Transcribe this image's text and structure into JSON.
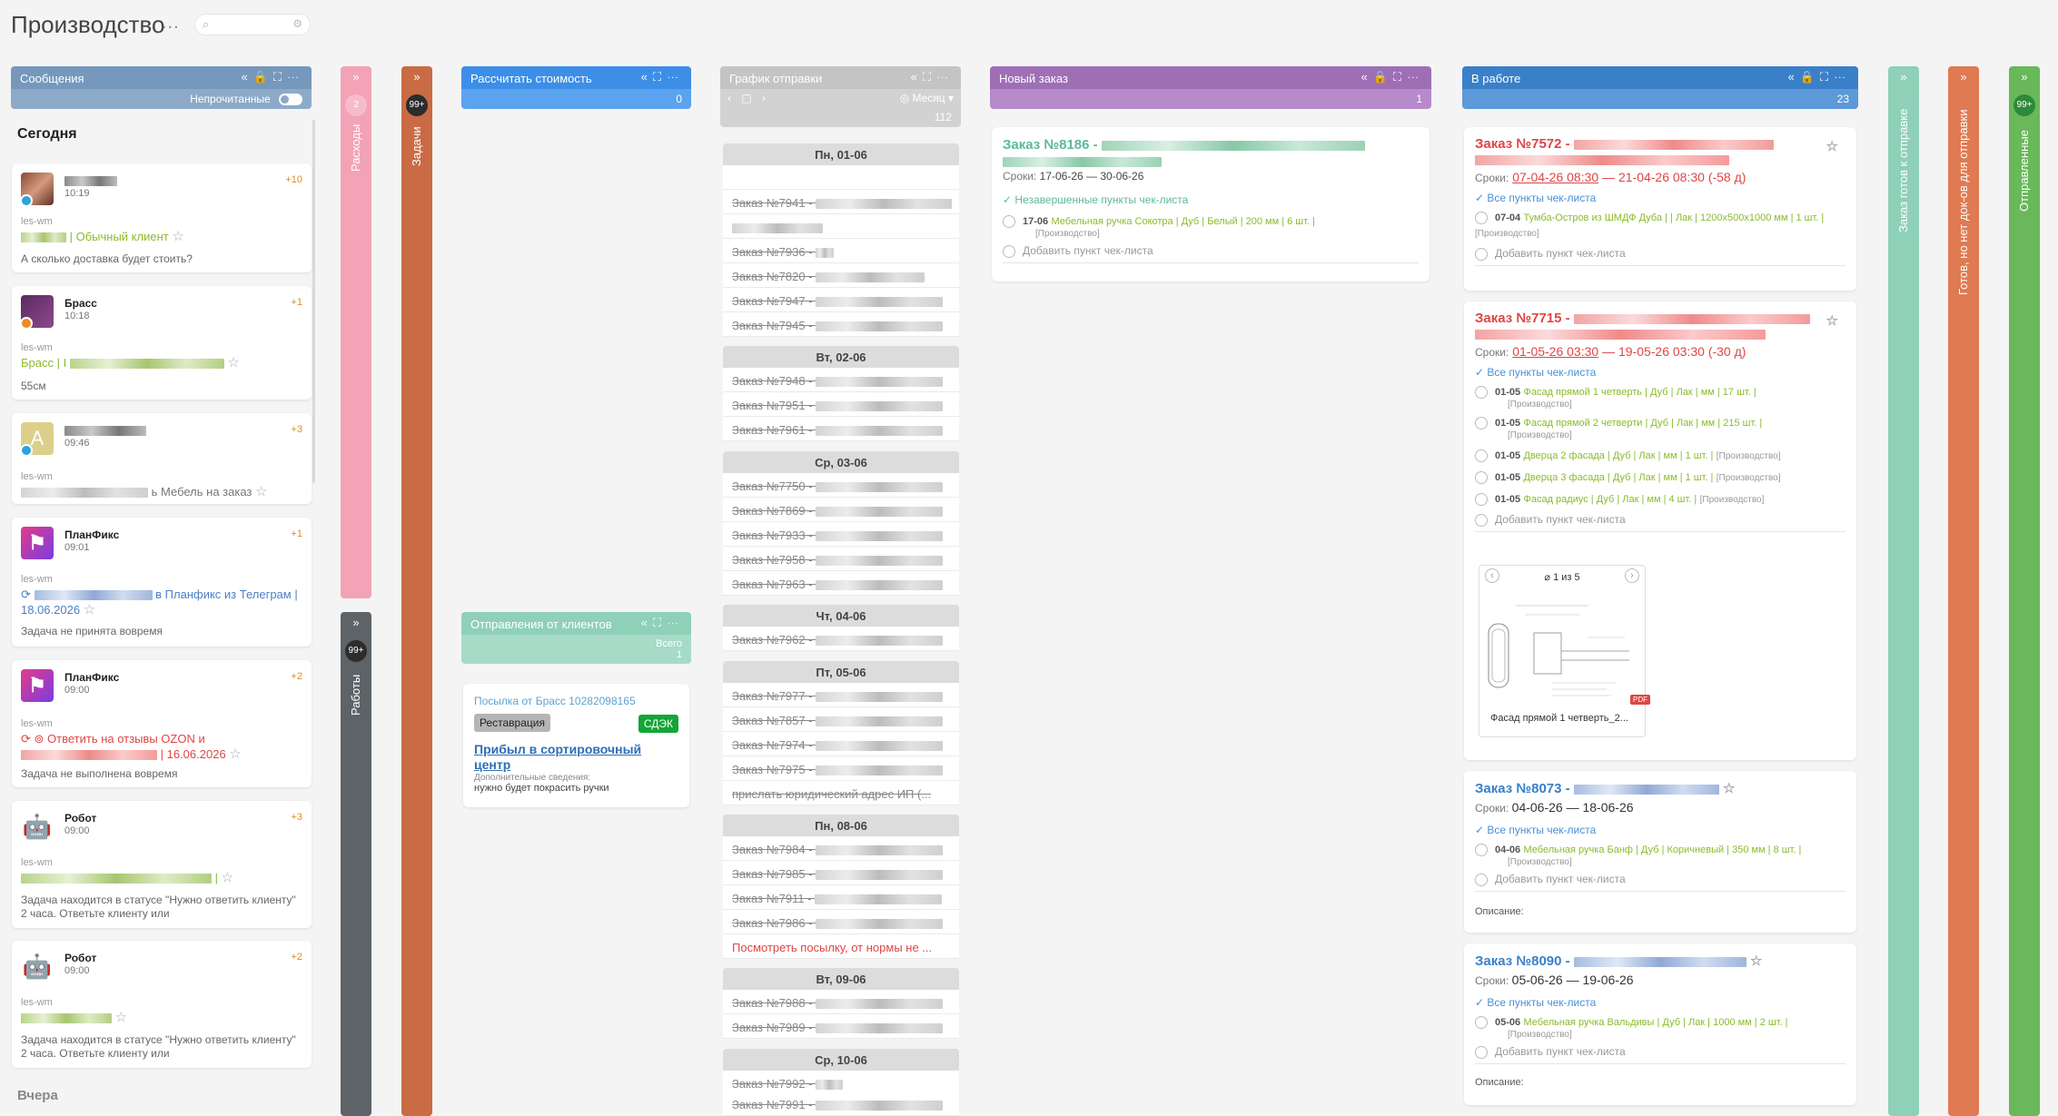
{
  "header": {
    "title": "Производство",
    "dots": "..."
  },
  "messages": {
    "title": "Сообщения",
    "unread_label": "Непрочитанные",
    "today": "Сегодня",
    "yesterday": "Вчера",
    "items": [
      {
        "time": "10:19",
        "count": "+10",
        "source": "les-wm",
        "subject": "| Обычный клиент",
        "text": "А сколько доставка будет стоить?"
      },
      {
        "name": "Брасс",
        "time": "10:18",
        "count": "+1",
        "source": "les-wm",
        "subject": "Брасс | I",
        "text": "55см"
      },
      {
        "time": "09:46",
        "count": "+3",
        "source": "les-wm",
        "subject": "ь Мебель на заказ",
        "text": ""
      },
      {
        "name": "ПланФикс",
        "time": "09:01",
        "count": "+1",
        "source": "les-wm",
        "subject": "в Планфикс из Телеграм | 18.06.2026",
        "text": "Задача не принята вовремя"
      },
      {
        "name": "ПланФикс",
        "time": "09:00",
        "count": "+2",
        "source": "les-wm",
        "subject": "Ответить на отзывы OZON и",
        "subject2": "| 16.06.2026",
        "text": "Задача не выполнена вовремя"
      },
      {
        "name": "Робот",
        "time": "09:00",
        "count": "+3",
        "source": "les-wm",
        "subject": "|",
        "text": "Задача находится в статусе \"Нужно ответить клиенту\" 2 часа. Ответьте клиенту или"
      },
      {
        "name": "Робот",
        "time": "09:00",
        "count": "+2",
        "source": "les-wm",
        "subject": "",
        "text": "Задача находится в статусе \"Нужно ответить клиенту\" 2 часа. Ответьте клиенту или"
      }
    ]
  },
  "columns": {
    "expenses": {
      "label": "Расходы",
      "badge": "2"
    },
    "tasks": {
      "label": "Задачи",
      "badge": "99+"
    },
    "works": {
      "label": "Работы",
      "badge": "99+"
    },
    "calc": {
      "title": "Рассчитать стоимость",
      "count": "0"
    },
    "client_shipments": {
      "title": "Отправления от клиентов",
      "total_label": "Всего",
      "total": "1"
    },
    "schedule": {
      "title": "График отправки",
      "view": "Месяц",
      "count": "112"
    },
    "new_order": {
      "title": "Новый заказ",
      "count": "1"
    },
    "in_work": {
      "title": "В работе",
      "count": "23"
    },
    "ready": {
      "label": "Заказ готов к отправке"
    },
    "docs": {
      "label": "Готов, но нет док-ов для отправки"
    },
    "sent": {
      "label": "Отправленные",
      "badge": "99+"
    }
  },
  "shipment_card": {
    "parcel": "Посылка от Брасс 10282098165",
    "tag": "Реставрация",
    "carrier": "СДЭК",
    "status": "Прибыл в сортировочный центр",
    "extra_label": "Дополнительные сведения:",
    "extra_text": "нужно будет покрасить ручки"
  },
  "schedule_days": [
    {
      "day": "Пн, 01-06",
      "rows": [
        "",
        "Заказ №7941 -",
        "",
        "Заказ №7936 -",
        "Заказ №7820 -",
        "Заказ №7947 -",
        "Заказ №7945 -"
      ]
    },
    {
      "day": "Вт, 02-06",
      "rows": [
        "Заказ №7948 -",
        "Заказ №7951 -",
        "Заказ №7961 -"
      ]
    },
    {
      "day": "Ср, 03-06",
      "rows": [
        "Заказ №7750 -",
        "Заказ №7869 -",
        "Заказ №7933 -",
        "Заказ №7958 -",
        "Заказ №7963 -"
      ]
    },
    {
      "day": "Чт, 04-06",
      "rows": [
        "Заказ №7962 -"
      ]
    },
    {
      "day": "Пт, 05-06",
      "rows": [
        "Заказ №7977 -",
        "Заказ №7857 -",
        "Заказ №7974 -",
        "Заказ №7975 -",
        "прислать юридический адрес ИП (..."
      ]
    },
    {
      "day": "Пн, 08-06",
      "rows": [
        "Заказ №7984 -",
        "Заказ №7985 -",
        "Заказ №7911 -",
        "Заказ №7986 -",
        "Посмотреть посылку, от нормы не ..."
      ]
    },
    {
      "day": "Вт, 09-06",
      "rows": [
        "Заказ №7988 -",
        "Заказ №7989 -"
      ]
    },
    {
      "day": "Ср, 10-06",
      "rows": [
        "Заказ №7992 -",
        "Заказ №7991 -"
      ]
    }
  ],
  "new_order_card": {
    "title": "Заказ №8186 -",
    "terms_label": "Сроки:",
    "terms": "17-06-26 — 30-06-26",
    "checklist_status": "Незавершенные пункты чек-листа",
    "items": [
      {
        "date": "17-06",
        "text": "Мебельная ручка Сокотра | Дуб | Белый | 200 мм | 6 шт. |",
        "tag": "[Производство]"
      }
    ],
    "add": "Добавить пункт чек-листа"
  },
  "work_cards": [
    {
      "title": "Заказ №7572 -",
      "terms_from": "07-04-26 08:30",
      "terms_to": "21-04-26 08:30",
      "overdue": "(-58 д)",
      "checklist_status": "Все пункты чек-листа",
      "items": [
        {
          "date": "07-04",
          "text": "Тумба-Остров из ШМДФ Дуба | | Лак | 1200x500x1000 мм | 1 шт. |",
          "tag": "[Производство]"
        }
      ]
    },
    {
      "title": "Заказ №7715 -",
      "terms_from": "01-05-26 03:30",
      "terms_to": "19-05-26 03:30",
      "overdue": "(-30 д)",
      "checklist_status": "Все пункты чек-листа",
      "items": [
        {
          "date": "01-05",
          "text": "Фасад прямой 1 четверть | Дуб | Лак | мм | 17 шт. |",
          "tag": "[Производство]"
        },
        {
          "date": "01-05",
          "text": "Фасад прямой 2 четверти | Дуб | Лак | мм | 215 шт. |",
          "tag": "[Производство]"
        },
        {
          "date": "01-05",
          "text": "Дверца 2 фасада | Дуб | Лак | мм | 1 шт. |",
          "tag": "[Производство]"
        },
        {
          "date": "01-05",
          "text": "Дверца 3 фасада | Дуб | Лак | мм | 1 шт. |",
          "tag": "[Производство]"
        },
        {
          "date": "01-05",
          "text": "Фасад радиус | Дуб | Лак | мм | 4 шт. |",
          "tag": "[Производство]"
        }
      ],
      "attachment": {
        "counter": "1 из 5",
        "name": "Фасад прямой 1 четверть_2..."
      }
    },
    {
      "title": "Заказ №8073 -",
      "terms": "04-06-26 — 18-06-26",
      "checklist_status": "Все пункты чек-листа",
      "items": [
        {
          "date": "04-06",
          "text": "Мебельная ручка Банф | Дуб | Коричневый | 350 мм | 8 шт. |",
          "tag": "[Производство]"
        }
      ],
      "description": "Описание:"
    },
    {
      "title": "Заказ №8090 -",
      "terms": "05-06-26 — 19-06-26",
      "checklist_status": "Все пункты чек-листа",
      "items": [
        {
          "date": "05-06",
          "text": "Мебельная ручка Вальдивы | Дуб | Лак | 1000 мм | 2 шт. |",
          "tag": "[Производство]"
        }
      ],
      "description": "Описание:"
    }
  ],
  "common": {
    "terms_label": "Сроки:",
    "add": "Добавить пункт чек-листа",
    "pdf": "PDF",
    "dash": "—"
  },
  "colors": {
    "messages": "#7698bc",
    "calc": "#3d8ee6",
    "schedule": "#c4c4c4",
    "new_order": "#9f6fb6",
    "in_work": "#3a80c8",
    "expenses": "#f3a3b6",
    "tasks": "#c96b45",
    "works": "#5d6367",
    "ready": "#8fd0b9",
    "docs": "#df7a52",
    "sent": "#69b85a"
  }
}
